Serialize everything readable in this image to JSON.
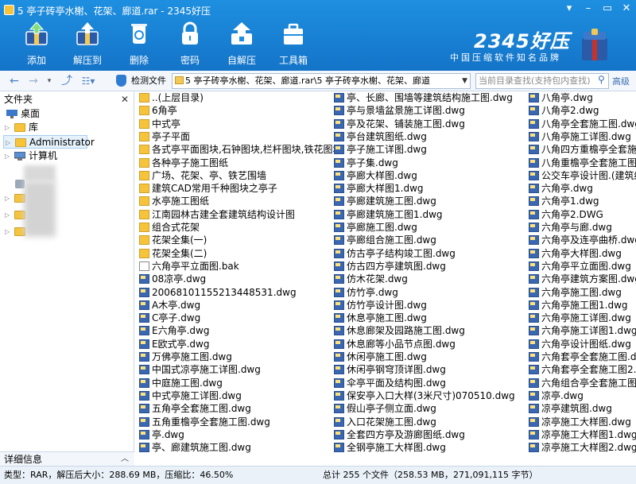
{
  "window": {
    "title": "5 亭子砖亭水榭、花架、廊道.rar - 2345好压",
    "controls": [
      "minimize",
      "restore",
      "close"
    ]
  },
  "toolbar": {
    "buttons": [
      {
        "label": "添加",
        "icon": "add-icon"
      },
      {
        "label": "解压到",
        "icon": "extract-icon"
      },
      {
        "label": "删除",
        "icon": "delete-icon"
      },
      {
        "label": "密码",
        "icon": "lock-icon"
      },
      {
        "label": "自解压",
        "icon": "self-extract-icon"
      },
      {
        "label": "工具箱",
        "icon": "toolbox-icon"
      }
    ]
  },
  "brand": {
    "logo": "2345好压",
    "slogan": "中国压缩软件知名品牌"
  },
  "navbar": {
    "scan_label": "检测文件",
    "path": "5 亭子砖亭水榭、花架、廊道.rar\\5 亭子砖亭水榭、花架、廊道",
    "search_placeholder": "当前目录查找(支持包内查找)",
    "advanced_label": "高级"
  },
  "left_pane": {
    "header": "文件夹",
    "tree": [
      {
        "label": "桌面",
        "icon": "desktop-icon"
      },
      {
        "label": "库",
        "icon": "library-icon"
      },
      {
        "label": "Administrator",
        "icon": "user-folder-icon"
      },
      {
        "label": "计算机",
        "icon": "computer-icon"
      },
      {
        "label": "网络",
        "icon": "network-icon"
      }
    ],
    "detail_header": "详细信息"
  },
  "files": {
    "column1": [
      {
        "name": "..(上层目录)",
        "type": "up"
      },
      {
        "name": "6角亭",
        "type": "folder"
      },
      {
        "name": "中式亭",
        "type": "folder"
      },
      {
        "name": "亭子平面",
        "type": "folder"
      },
      {
        "name": "各式亭平面图块,石钟图块,栏杆图块,铁花图块",
        "type": "folder"
      },
      {
        "name": "各种亭子施工图纸",
        "type": "folder"
      },
      {
        "name": "广场、花架、亭、铁艺围墙",
        "type": "folder"
      },
      {
        "name": "建筑CAD常用千种图块之亭子",
        "type": "folder"
      },
      {
        "name": "水亭施工图纸",
        "type": "folder"
      },
      {
        "name": "江南园林古建全套建筑结构设计图",
        "type": "folder"
      },
      {
        "name": "组合式花架",
        "type": "folder"
      },
      {
        "name": "花架全集(一)",
        "type": "folder"
      },
      {
        "name": "花架全集(二)",
        "type": "folder"
      },
      {
        "name": "六角亭平立面图.bak",
        "type": "bak"
      },
      {
        "name": "08凉亭.dwg",
        "type": "dwg"
      },
      {
        "name": "20068101155213448531.dwg",
        "type": "dwg"
      },
      {
        "name": "A木亭.dwg",
        "type": "dwg"
      },
      {
        "name": "C亭子.dwg",
        "type": "dwg"
      },
      {
        "name": "E六角亭.dwg",
        "type": "dwg"
      },
      {
        "name": "E欧式亭.dwg",
        "type": "dwg"
      },
      {
        "name": "万佛亭施工图.dwg",
        "type": "dwg"
      },
      {
        "name": "中国式凉亭施工详图.dwg",
        "type": "dwg"
      },
      {
        "name": "中庭施工图.dwg",
        "type": "dwg"
      },
      {
        "name": "中式亭施工详图.dwg",
        "type": "dwg"
      },
      {
        "name": "五角亭全套施工图.dwg",
        "type": "dwg"
      },
      {
        "name": "五角重檐亭全套施工图.dwg",
        "type": "dwg"
      },
      {
        "name": "亭.dwg",
        "type": "dwg"
      },
      {
        "name": "亭、廊建筑施工图.dwg",
        "type": "dwg"
      }
    ],
    "column2": [
      {
        "name": "亭、长廊、围墙等建筑结构施工图.dwg",
        "type": "dwg"
      },
      {
        "name": "亭与景墙盆景施工详图.dwg",
        "type": "dwg"
      },
      {
        "name": "亭及花架、铺装施工图.dwg",
        "type": "dwg"
      },
      {
        "name": "亭台建筑图纸.dwg",
        "type": "dwg"
      },
      {
        "name": "亭子施工详图.dwg",
        "type": "dwg"
      },
      {
        "name": "亭子集.dwg",
        "type": "dwg"
      },
      {
        "name": "亭廊大样图.dwg",
        "type": "dwg"
      },
      {
        "name": "亭廊大样图1.dwg",
        "type": "dwg"
      },
      {
        "name": "亭廊建筑施工图.dwg",
        "type": "dwg"
      },
      {
        "name": "亭廊建筑施工图1.dwg",
        "type": "dwg"
      },
      {
        "name": "亭廊施工图.dwg",
        "type": "dwg"
      },
      {
        "name": "亭廊组合施工图.dwg",
        "type": "dwg"
      },
      {
        "name": "仿古亭子结构竣工图.dwg",
        "type": "dwg"
      },
      {
        "name": "仿古四方亭建筑图.dwg",
        "type": "dwg"
      },
      {
        "name": "仿木花架.dwg",
        "type": "dwg"
      },
      {
        "name": "仿竹亭.dwg",
        "type": "dwg"
      },
      {
        "name": "仿竹亭设计图.dwg",
        "type": "dwg"
      },
      {
        "name": "休息亭施工图.dwg",
        "type": "dwg"
      },
      {
        "name": "休息廊架及园路施工图.dwg",
        "type": "dwg"
      },
      {
        "name": "休息廊等小品节点图.dwg",
        "type": "dwg"
      },
      {
        "name": "休闲亭施工图.dwg",
        "type": "dwg"
      },
      {
        "name": "休闲亭钢穹顶详图.dwg",
        "type": "dwg"
      },
      {
        "name": "伞亭平面及结构图.dwg",
        "type": "dwg"
      },
      {
        "name": "保安亭入口大样(3米尺寸)070510.dwg",
        "type": "dwg"
      },
      {
        "name": "假山亭子侧立面.dwg",
        "type": "dwg"
      },
      {
        "name": "入口花架施工图.dwg",
        "type": "dwg"
      },
      {
        "name": "全套四方亭及游廊图纸.dwg",
        "type": "dwg"
      },
      {
        "name": "全钢亭施工大样图.dwg",
        "type": "dwg"
      }
    ],
    "column3": [
      {
        "name": "八角亭.dwg",
        "type": "dwg"
      },
      {
        "name": "八角亭2.dwg",
        "type": "dwg"
      },
      {
        "name": "八角亭全套施工图.dwg",
        "type": "dwg"
      },
      {
        "name": "八角亭施工详图.dwg",
        "type": "dwg"
      },
      {
        "name": "八角四方重檐亭全套施工图",
        "type": "dwg"
      },
      {
        "name": "八角重檐亭全套施工图.dwg",
        "type": "dwg"
      },
      {
        "name": "公交车亭设计图.(建筑结构",
        "type": "dwg"
      },
      {
        "name": "六角亭.dwg",
        "type": "dwg"
      },
      {
        "name": "六角亭1.dwg",
        "type": "dwg"
      },
      {
        "name": "六角亭2.DWG",
        "type": "dwg"
      },
      {
        "name": "六角亭与廊.dwg",
        "type": "dwg"
      },
      {
        "name": "六角亭及连亭曲桥.dwg",
        "type": "dwg"
      },
      {
        "name": "六角亭大样图.dwg",
        "type": "dwg"
      },
      {
        "name": "六角亭平立面图.dwg",
        "type": "dwg"
      },
      {
        "name": "六角亭建筑方案图.dwg",
        "type": "dwg"
      },
      {
        "name": "六角亭施工图.dwg",
        "type": "dwg"
      },
      {
        "name": "六角亭施工图1.dwg",
        "type": "dwg"
      },
      {
        "name": "六角亭施工详图.dwg",
        "type": "dwg"
      },
      {
        "name": "六角亭施工详图1.dwg",
        "type": "dwg"
      },
      {
        "name": "六角亭设计图纸.dwg",
        "type": "dwg"
      },
      {
        "name": "六角套亭全套施工图.dwg",
        "type": "dwg"
      },
      {
        "name": "六角套亭全套施工图2.dwg",
        "type": "dwg"
      },
      {
        "name": "六角组合亭全套施工图 .dv",
        "type": "dwg"
      },
      {
        "name": "凉亭.dwg",
        "type": "dwg"
      },
      {
        "name": "凉亭建筑图.dwg",
        "type": "dwg"
      },
      {
        "name": "凉亭施工大样图.dwg",
        "type": "dwg"
      },
      {
        "name": "凉亭施工大样图1.dwg",
        "type": "dwg"
      },
      {
        "name": "凉亭施工大样图2.dwg",
        "type": "dwg"
      }
    ]
  },
  "status": {
    "left": "类型：RAR，解压后大小：288.69 MB，压缩比：46.50%",
    "right": "总计 255 个文件（258.53 MB，271,091,115 字节）"
  },
  "colors": {
    "titlebar": "#1474c8",
    "accent": "#1e8fe0",
    "folder": "#f6c33b",
    "dwg": "#3b67b0"
  }
}
